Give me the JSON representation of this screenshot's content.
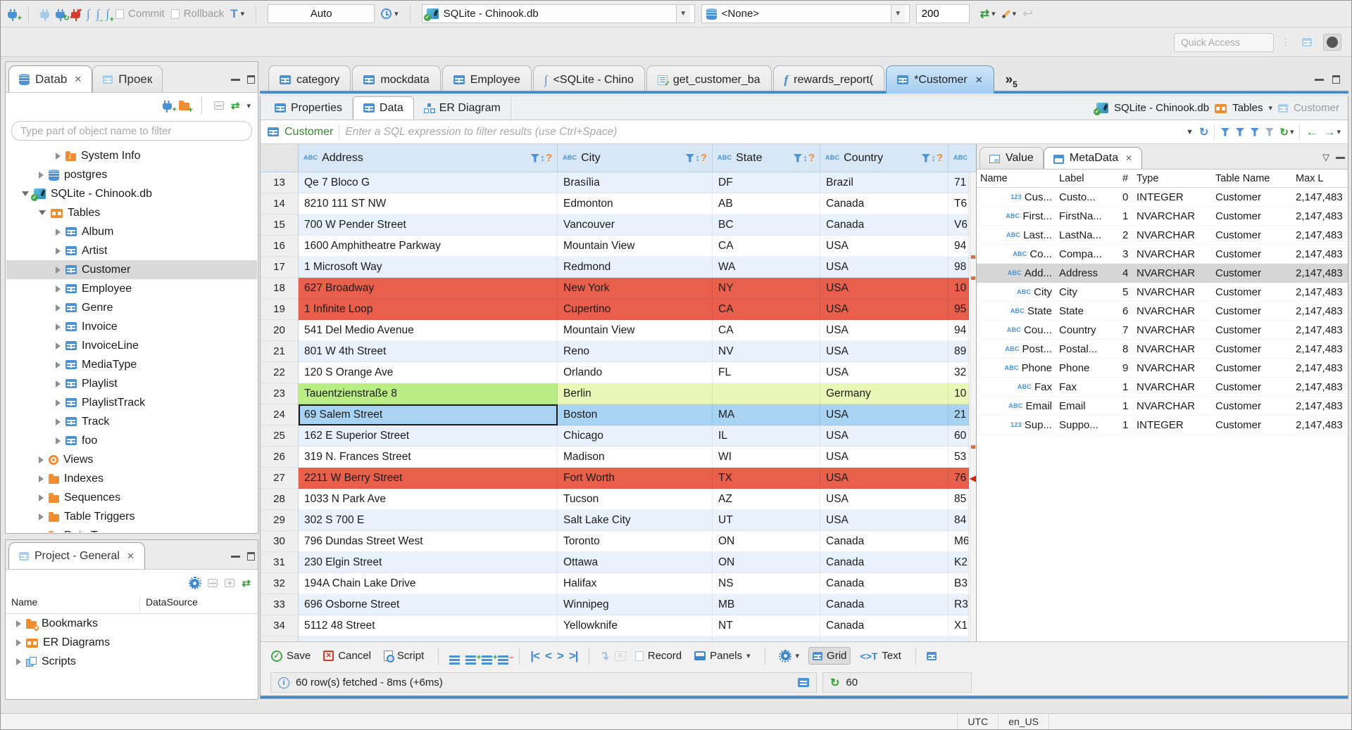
{
  "toolbar": {
    "commit": "Commit",
    "rollback": "Rollback",
    "auto": "Auto",
    "database": "SQLite - Chinook.db",
    "schema": "<None>",
    "fetch_size": "200",
    "quick_access": "Quick Access"
  },
  "nav": {
    "tab_database": "Datab",
    "tab_project": "Проек",
    "filter_placeholder": "Type part of object name to filter",
    "tree": [
      {
        "label": "System Info",
        "icon": "info-folder",
        "indent": 2,
        "arrow": "right"
      },
      {
        "label": "postgres",
        "icon": "db",
        "indent": 1,
        "arrow": "right"
      },
      {
        "label": "SQLite - Chinook.db",
        "icon": "sqlite",
        "indent": 0,
        "arrow": "down"
      },
      {
        "label": "Tables",
        "icon": "tables",
        "indent": 1,
        "arrow": "down"
      },
      {
        "label": "Album",
        "icon": "table",
        "indent": 2,
        "arrow": "right"
      },
      {
        "label": "Artist",
        "icon": "table",
        "indent": 2,
        "arrow": "right"
      },
      {
        "label": "Customer",
        "icon": "table",
        "indent": 2,
        "arrow": "right",
        "selected": true
      },
      {
        "label": "Employee",
        "icon": "table",
        "indent": 2,
        "arrow": "right"
      },
      {
        "label": "Genre",
        "icon": "table",
        "indent": 2,
        "arrow": "right"
      },
      {
        "label": "Invoice",
        "icon": "table",
        "indent": 2,
        "arrow": "right"
      },
      {
        "label": "InvoiceLine",
        "icon": "table",
        "indent": 2,
        "arrow": "right"
      },
      {
        "label": "MediaType",
        "icon": "table",
        "indent": 2,
        "arrow": "right"
      },
      {
        "label": "Playlist",
        "icon": "table",
        "indent": 2,
        "arrow": "right"
      },
      {
        "label": "PlaylistTrack",
        "icon": "table",
        "indent": 2,
        "arrow": "right"
      },
      {
        "label": "Track",
        "icon": "table",
        "indent": 2,
        "arrow": "right"
      },
      {
        "label": "foo",
        "icon": "table",
        "indent": 2,
        "arrow": "right"
      },
      {
        "label": "Views",
        "icon": "views",
        "indent": 1,
        "arrow": "right"
      },
      {
        "label": "Indexes",
        "icon": "folder",
        "indent": 1,
        "arrow": "right"
      },
      {
        "label": "Sequences",
        "icon": "folder",
        "indent": 1,
        "arrow": "right"
      },
      {
        "label": "Table Triggers",
        "icon": "folder",
        "indent": 1,
        "arrow": "right"
      },
      {
        "label": "Data Types",
        "icon": "folder",
        "indent": 1,
        "arrow": "right"
      }
    ]
  },
  "project": {
    "title": "Project - General",
    "col_name": "Name",
    "col_datasource": "DataSource",
    "items": [
      {
        "label": "Bookmarks",
        "icon": "folder-star"
      },
      {
        "label": "ER Diagrams",
        "icon": "er"
      },
      {
        "label": "Scripts",
        "icon": "scripts"
      }
    ]
  },
  "editor": {
    "tabs": [
      {
        "label": "category",
        "icon": "table"
      },
      {
        "label": "mockdata",
        "icon": "table"
      },
      {
        "label": "Employee",
        "icon": "table"
      },
      {
        "label": "<SQLite - Chino",
        "icon": "sql"
      },
      {
        "label": "get_customer_ba",
        "icon": "script"
      },
      {
        "label": "rewards_report(",
        "icon": "func"
      },
      {
        "label": "*Customer",
        "icon": "table",
        "selected": true,
        "closable": true
      }
    ],
    "overflow_count": "5",
    "subtabs": [
      {
        "label": "Properties",
        "icon": "table"
      },
      {
        "label": "Data",
        "icon": "data",
        "selected": true
      },
      {
        "label": "ER Diagram",
        "icon": "erb"
      }
    ],
    "breadcrumb": {
      "database": "SQLite - Chinook.db",
      "container": "Tables",
      "entity": "Customer"
    }
  },
  "filterbar": {
    "entity": "Customer",
    "placeholder": "Enter a SQL expression to filter results (use Ctrl+Space)"
  },
  "grid": {
    "columns": [
      "Address",
      "City",
      "State",
      "Country"
    ],
    "rows": [
      {
        "n": "13",
        "address": "Qe 7 Bloco G",
        "city": "Brasília",
        "state": "DF",
        "country": "Brazil",
        "extra": "71"
      },
      {
        "n": "14",
        "address": "8210 111 ST NW",
        "city": "Edmonton",
        "state": "AB",
        "country": "Canada",
        "extra": "T6"
      },
      {
        "n": "15",
        "address": "700 W Pender Street",
        "city": "Vancouver",
        "state": "BC",
        "country": "Canada",
        "extra": "V6"
      },
      {
        "n": "16",
        "address": "1600 Amphitheatre Parkway",
        "city": "Mountain View",
        "state": "CA",
        "country": "USA",
        "extra": "94"
      },
      {
        "n": "17",
        "address": "1 Microsoft Way",
        "city": "Redmond",
        "state": "WA",
        "country": "USA",
        "extra": "98"
      },
      {
        "n": "18",
        "address": "627 Broadway",
        "city": "New York",
        "state": "NY",
        "country": "USA",
        "extra": "10",
        "style": "red"
      },
      {
        "n": "19",
        "address": "1 Infinite Loop",
        "city": "Cupertino",
        "state": "CA",
        "country": "USA",
        "extra": "95",
        "style": "red"
      },
      {
        "n": "20",
        "address": "541 Del Medio Avenue",
        "city": "Mountain View",
        "state": "CA",
        "country": "USA",
        "extra": "94"
      },
      {
        "n": "21",
        "address": "801 W 4th Street",
        "city": "Reno",
        "state": "NV",
        "country": "USA",
        "extra": "89"
      },
      {
        "n": "22",
        "address": "120 S Orange Ave",
        "city": "Orlando",
        "state": "FL",
        "country": "USA",
        "extra": "32"
      },
      {
        "n": "23",
        "address": "Tauentzienstraße 8",
        "city": "Berlin",
        "state": "",
        "country": "Germany",
        "extra": "10",
        "style": "green"
      },
      {
        "n": "24",
        "address": "69 Salem Street",
        "city": "Boston",
        "state": "MA",
        "country": "USA",
        "extra": "21",
        "style": "selected"
      },
      {
        "n": "25",
        "address": "162 E Superior Street",
        "city": "Chicago",
        "state": "IL",
        "country": "USA",
        "extra": "60"
      },
      {
        "n": "26",
        "address": "319 N. Frances Street",
        "city": "Madison",
        "state": "WI",
        "country": "USA",
        "extra": "53"
      },
      {
        "n": "27",
        "address": "2211 W Berry Street",
        "city": "Fort Worth",
        "state": "TX",
        "country": "USA",
        "extra": "76",
        "style": "red"
      },
      {
        "n": "28",
        "address": "1033 N Park Ave",
        "city": "Tucson",
        "state": "AZ",
        "country": "USA",
        "extra": "85"
      },
      {
        "n": "29",
        "address": "302 S 700 E",
        "city": "Salt Lake City",
        "state": "UT",
        "country": "USA",
        "extra": "84"
      },
      {
        "n": "30",
        "address": "796 Dundas Street West",
        "city": "Toronto",
        "state": "ON",
        "country": "Canada",
        "extra": "M6"
      },
      {
        "n": "31",
        "address": "230 Elgin Street",
        "city": "Ottawa",
        "state": "ON",
        "country": "Canada",
        "extra": "K2"
      },
      {
        "n": "32",
        "address": "194A Chain Lake Drive",
        "city": "Halifax",
        "state": "NS",
        "country": "Canada",
        "extra": "B3"
      },
      {
        "n": "33",
        "address": "696 Osborne Street",
        "city": "Winnipeg",
        "state": "MB",
        "country": "Canada",
        "extra": "R3"
      },
      {
        "n": "34",
        "address": "5112 48 Street",
        "city": "Yellowknife",
        "state": "NT",
        "country": "Canada",
        "extra": "X1"
      }
    ]
  },
  "resultbar": {
    "save": "Save",
    "cancel": "Cancel",
    "script": "Script",
    "record": "Record",
    "panels": "Panels",
    "grid": "Grid",
    "text": "Text",
    "status": "60 row(s) fetched - 8ms (+6ms)",
    "fetch_count": "60"
  },
  "metadata": {
    "tab_value": "Value",
    "tab_metadata": "MetaData",
    "columns": [
      "Name",
      "Label",
      "#",
      "Type",
      "Table Name",
      "Max L"
    ],
    "rows": [
      {
        "kind": "123",
        "name": "Cus...",
        "label": "Custo...",
        "num": "0",
        "type": "INTEGER",
        "table": "Customer",
        "max": "2,147,483"
      },
      {
        "kind": "ABC",
        "name": "First...",
        "label": "FirstNa...",
        "num": "1",
        "type": "NVARCHAR",
        "table": "Customer",
        "max": "2,147,483"
      },
      {
        "kind": "ABC",
        "name": "Last...",
        "label": "LastNa...",
        "num": "2",
        "type": "NVARCHAR",
        "table": "Customer",
        "max": "2,147,483"
      },
      {
        "kind": "ABC",
        "name": "Co...",
        "label": "Compa...",
        "num": "3",
        "type": "NVARCHAR",
        "table": "Customer",
        "max": "2,147,483"
      },
      {
        "kind": "ABC",
        "name": "Add...",
        "label": "Address",
        "num": "4",
        "type": "NVARCHAR",
        "table": "Customer",
        "max": "2,147,483",
        "selected": true
      },
      {
        "kind": "ABC",
        "name": "City",
        "label": "City",
        "num": "5",
        "type": "NVARCHAR",
        "table": "Customer",
        "max": "2,147,483"
      },
      {
        "kind": "ABC",
        "name": "State",
        "label": "State",
        "num": "6",
        "type": "NVARCHAR",
        "table": "Customer",
        "max": "2,147,483"
      },
      {
        "kind": "ABC",
        "name": "Cou...",
        "label": "Country",
        "num": "7",
        "type": "NVARCHAR",
        "table": "Customer",
        "max": "2,147,483"
      },
      {
        "kind": "ABC",
        "name": "Post...",
        "label": "Postal...",
        "num": "8",
        "type": "NVARCHAR",
        "table": "Customer",
        "max": "2,147,483"
      },
      {
        "kind": "ABC",
        "name": "Phone",
        "label": "Phone",
        "num": "9",
        "type": "NVARCHAR",
        "table": "Customer",
        "max": "2,147,483"
      },
      {
        "kind": "ABC",
        "name": "Fax",
        "label": "Fax",
        "num": "1",
        "type": "NVARCHAR",
        "table": "Customer",
        "max": "2,147,483"
      },
      {
        "kind": "ABC",
        "name": "Email",
        "label": "Email",
        "num": "1",
        "type": "NVARCHAR",
        "table": "Customer",
        "max": "2,147,483"
      },
      {
        "kind": "123",
        "name": "Sup...",
        "label": "Suppo...",
        "num": "1",
        "type": "INTEGER",
        "table": "Customer",
        "max": "2,147,483"
      }
    ]
  },
  "statusbar": {
    "timezone": "UTC",
    "locale": "en_US"
  }
}
